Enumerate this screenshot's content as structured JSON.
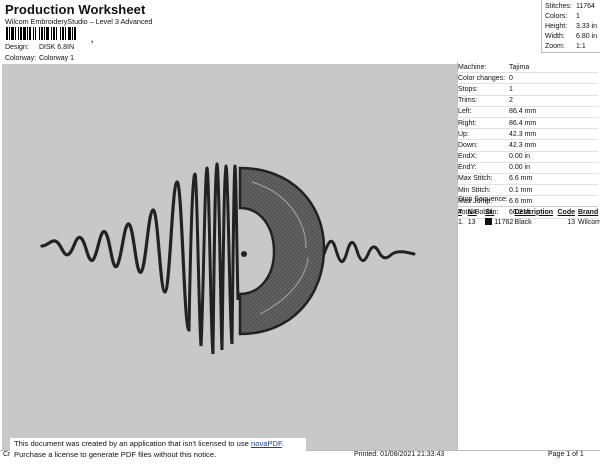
{
  "header": {
    "title": "Production Worksheet",
    "subtitle": "Wilcom EmbroideryStudio – Level 3 Advanced",
    "barcode_mark": ","
  },
  "design_info": [
    {
      "key": "Design:",
      "value": "DISK 6,8IN"
    },
    {
      "key": "Colorway:",
      "value": "Colorway 1"
    }
  ],
  "stats": [
    {
      "key": "Stitches:",
      "value": "11764"
    },
    {
      "key": "Colors:",
      "value": "1"
    },
    {
      "key": "Height:",
      "value": "3.33 in"
    },
    {
      "key": "Width:",
      "value": "6.80 in"
    },
    {
      "key": "Zoom:",
      "value": "1:1"
    }
  ],
  "machine_info": [
    {
      "key": "Machine:",
      "value": "Tajima"
    },
    {
      "key": "Color changes:",
      "value": "0"
    },
    {
      "key": "Stops:",
      "value": "1"
    },
    {
      "key": "Trims:",
      "value": "2"
    },
    {
      "key": "Left:",
      "value": "86.4 mm"
    },
    {
      "key": "Right:",
      "value": "86.4 mm"
    },
    {
      "key": "Up:",
      "value": "42.3 mm"
    },
    {
      "key": "Down:",
      "value": "42.3 mm"
    },
    {
      "key": "EndX:",
      "value": "0.00 in"
    },
    {
      "key": "EndY:",
      "value": "0.00 in"
    },
    {
      "key": "Max Stitch:",
      "value": "6.6 mm"
    },
    {
      "key": "Min Stitch:",
      "value": "0.1 mm"
    },
    {
      "key": "Max Jump:",
      "value": "6.6 mm"
    },
    {
      "key": "Total Bobbin:",
      "value": "66.21ft"
    }
  ],
  "stop_sequence": {
    "heading": "Stop Sequence:",
    "columns": [
      "#",
      "N#",
      "St.",
      "Description",
      "Code",
      "Brand"
    ],
    "rows": [
      {
        "num": "1.",
        "needle": "13",
        "stitches": "11762",
        "description": "Black",
        "code": "13",
        "brand": "Wilcom",
        "color": "#111111"
      }
    ]
  },
  "notice": {
    "line1_prefix": "This document was created by an application that isn't licensed to use ",
    "link": "novaPDF",
    "line1_suffix": ".",
    "line2": "Purchase a license to generate PDF files without this notice."
  },
  "footer": {
    "left": "Cr",
    "printed": "Printed:  01/08/2021 21:33:43",
    "page": "Page 1 of 1"
  },
  "colors": {
    "canvas_bg": "#c8c8c8",
    "thread": "#2b2b2b"
  }
}
